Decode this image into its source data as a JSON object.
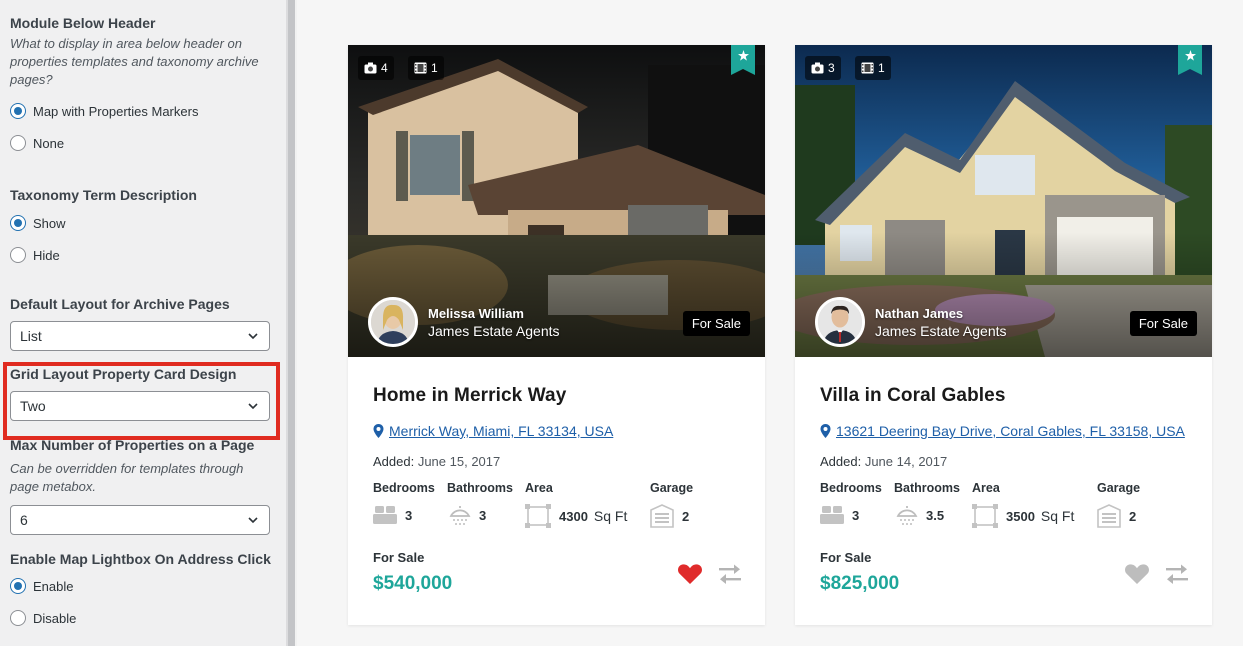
{
  "sidebar": {
    "module_below_header": {
      "title": "Module Below Header",
      "desc": "What to display in area below header on properties templates and taxonomy archive pages?",
      "options": [
        "Map with Properties Markers",
        "None"
      ],
      "selected": "Map with Properties Markers"
    },
    "taxonomy_desc": {
      "title": "Taxonomy Term Description",
      "options": [
        "Show",
        "Hide"
      ],
      "selected": "Show"
    },
    "default_layout": {
      "title": "Default Layout for Archive Pages",
      "value": "List"
    },
    "grid_card_design": {
      "title": "Grid Layout Property Card Design",
      "value": "Two"
    },
    "max_properties": {
      "title": "Max Number of Properties on a Page",
      "desc": "Can be overridden for templates through page metabox.",
      "value": "6"
    },
    "map_lightbox": {
      "title": "Enable Map Lightbox On Address Click",
      "options": [
        "Enable",
        "Disable"
      ],
      "selected": "Enable"
    }
  },
  "cards": [
    {
      "photos": "4",
      "videos": "1",
      "agent_name": "Melissa William",
      "agent_company": "James Estate Agents",
      "status_tag": "For Sale",
      "title": "Home in Merrick Way",
      "address": "Merrick Way, Miami, FL 33134, USA",
      "added_label": "Added:",
      "added_date": "June 15, 2017",
      "labels": {
        "bedrooms": "Bedrooms",
        "bathrooms": "Bathrooms",
        "area": "Area",
        "garage": "Garage"
      },
      "bedrooms": "3",
      "bathrooms": "3",
      "area": "4300",
      "area_unit": "Sq Ft",
      "garage": "2",
      "status": "For Sale",
      "price": "$540,000",
      "favorited": true
    },
    {
      "photos": "3",
      "videos": "1",
      "agent_name": "Nathan James",
      "agent_company": "James Estate Agents",
      "status_tag": "For Sale",
      "title": "Villa in Coral Gables",
      "address": "13621 Deering Bay Drive, Coral Gables, FL 33158, USA",
      "added_label": "Added:",
      "added_date": "June 14, 2017",
      "labels": {
        "bedrooms": "Bedrooms",
        "bathrooms": "Bathrooms",
        "area": "Area",
        "garage": "Garage"
      },
      "bedrooms": "3",
      "bathrooms": "3.5",
      "area": "3500",
      "area_unit": "Sq Ft",
      "garage": "2",
      "status": "For Sale",
      "price": "$825,000",
      "favorited": false
    }
  ],
  "colors": {
    "accent": "#1ea69a",
    "link": "#1e5fa8",
    "favorite_active": "#e02b2b",
    "favorite_inactive": "#bdbdbd",
    "highlight": "#e02b20"
  }
}
